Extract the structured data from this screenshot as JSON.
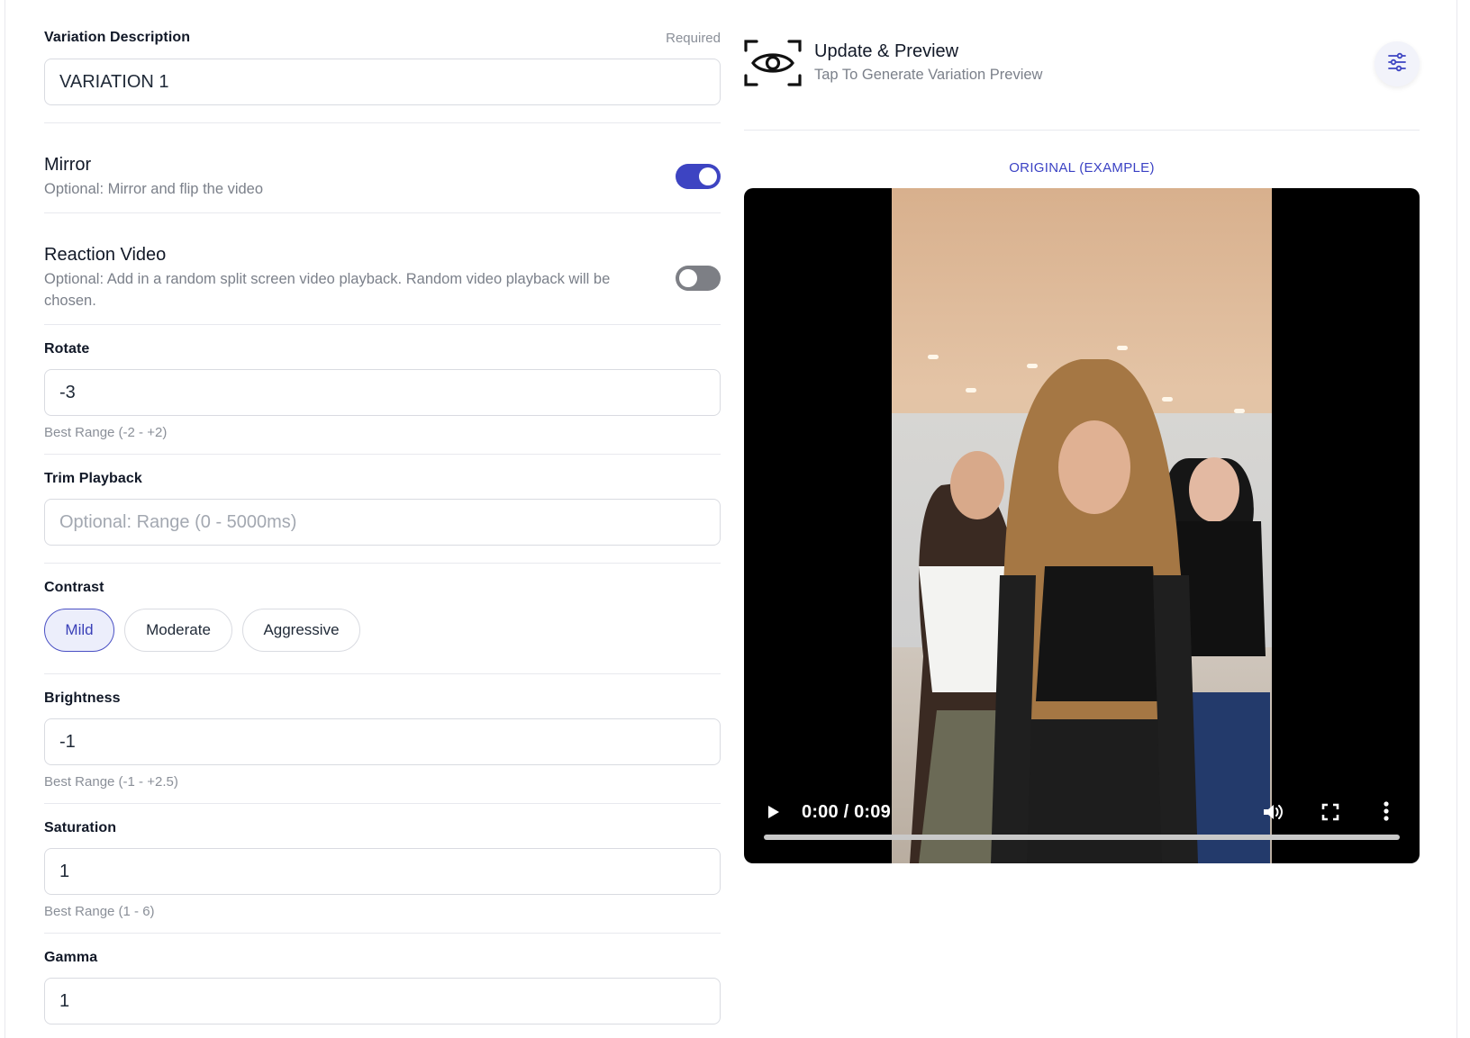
{
  "form": {
    "variation_description": {
      "label": "Variation Description",
      "required_text": "Required",
      "value": "VARIATION 1"
    },
    "mirror": {
      "title": "Mirror",
      "subtitle": "Optional: Mirror and flip the video",
      "enabled": true
    },
    "reaction_video": {
      "title": "Reaction Video",
      "subtitle": "Optional: Add in a random split screen video playback. Random video playback will be chosen.",
      "enabled": false
    },
    "rotate": {
      "label": "Rotate",
      "value": "-3",
      "hint": "Best Range (-2 - +2)"
    },
    "trim_playback": {
      "label": "Trim Playback",
      "value": "",
      "placeholder": "Optional: Range (0 - 5000ms)"
    },
    "contrast": {
      "label": "Contrast",
      "options": [
        "Mild",
        "Moderate",
        "Aggressive"
      ],
      "selected": "Mild"
    },
    "brightness": {
      "label": "Brightness",
      "value": "-1",
      "hint": "Best Range (-1 - +2.5)"
    },
    "saturation": {
      "label": "Saturation",
      "value": "1",
      "hint": "Best Range (1 - 6)"
    },
    "gamma": {
      "label": "Gamma",
      "value": "1"
    }
  },
  "preview": {
    "title": "Update & Preview",
    "subtitle": "Tap To Generate Variation Preview",
    "original_label": "ORIGINAL (EXAMPLE)",
    "video": {
      "time": "0:00 / 0:09",
      "progress": 0
    }
  },
  "colors": {
    "accent": "#3d44c2",
    "toggle_off": "#7d7f85"
  },
  "icons": [
    "eye-scan-icon",
    "sliders-icon",
    "play-icon",
    "volume-icon",
    "fullscreen-icon",
    "more-vertical-icon"
  ]
}
